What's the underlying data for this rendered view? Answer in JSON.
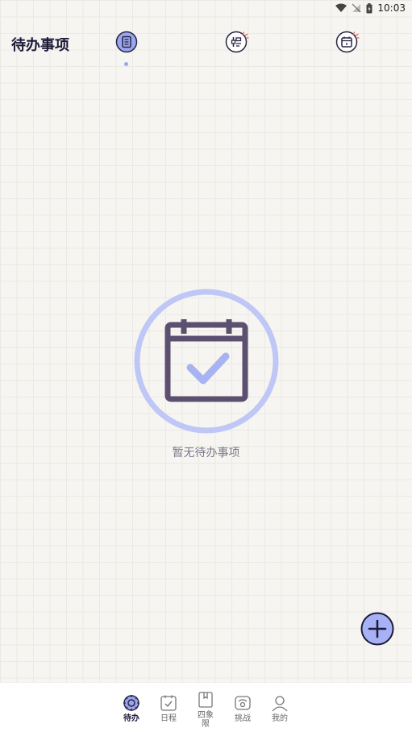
{
  "status_bar": {
    "time": "10:03"
  },
  "header": {
    "title": "待办事项"
  },
  "empty_state": {
    "message": "暂无待办事项"
  },
  "bottom_nav": {
    "items": [
      {
        "label": "待办",
        "icon": "todo-icon",
        "active": true
      },
      {
        "label": "日程",
        "icon": "schedule-icon",
        "active": false
      },
      {
        "label": "四象限",
        "icon": "quadrant-icon",
        "active": false
      },
      {
        "label": "挑战",
        "icon": "challenge-icon",
        "active": false
      },
      {
        "label": "我的",
        "icon": "profile-icon",
        "active": false
      }
    ]
  },
  "colors": {
    "accent": "#9aa6ee",
    "accent_light": "#bfc7f7",
    "dark": "#2a2545",
    "calendar_stroke": "#5b5070",
    "fab_fill": "#a6b2f5"
  }
}
